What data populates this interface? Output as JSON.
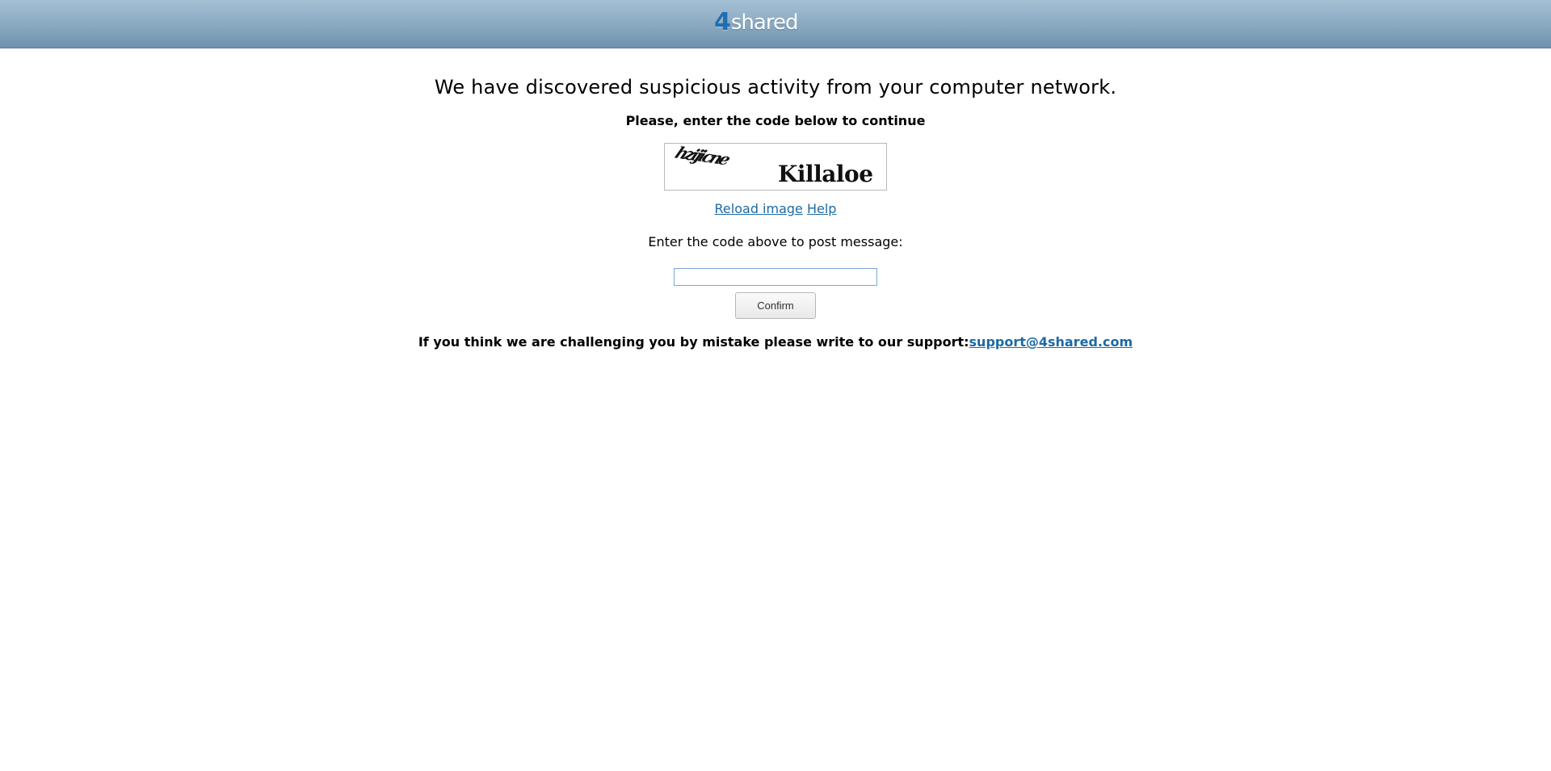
{
  "header": {
    "logo_number": "4",
    "logo_word": "shared"
  },
  "main": {
    "headline": "We have discovered suspicious activity from your computer network.",
    "prompt": "Please, enter the code below to continue",
    "captcha": {
      "distorted_text": "hzijicne",
      "word": "Killaloe"
    },
    "reload_label": "Reload image",
    "help_label": "Help",
    "code_label": "Enter the code above to post message:",
    "code_value": "",
    "confirm_label": "Confirm",
    "support_text": "If you think we are challenging you by mistake please write to our support:",
    "support_email": "support@4shared.com"
  },
  "colors": {
    "header_gradient_top": "#a4c0d5",
    "header_gradient_bottom": "#6f91ad",
    "logo_number": "#1f6fb0",
    "link": "#1b6aa5"
  }
}
